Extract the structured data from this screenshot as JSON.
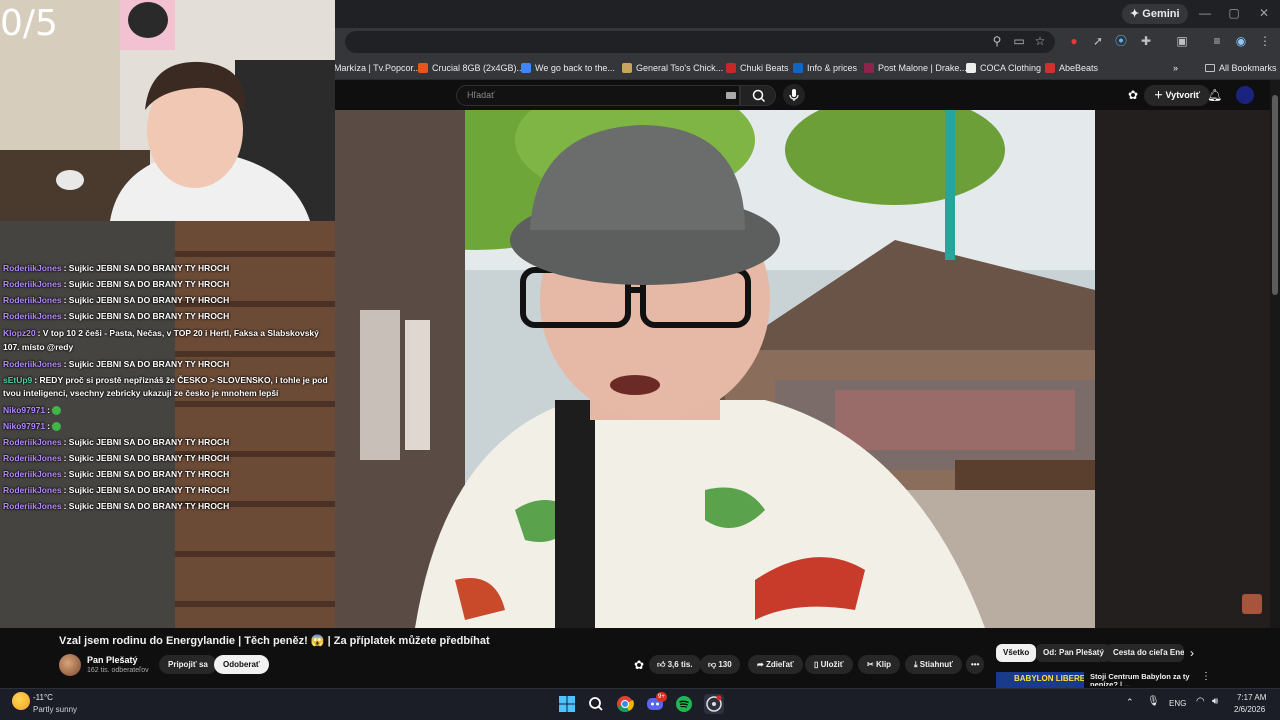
{
  "browser": {
    "gemini_label": "Gemini",
    "bookmarks": [
      {
        "label": "Markíza | Tv.Popcor...",
        "color": "#9aa0a6"
      },
      {
        "label": "Crucial 8GB (2x4GB)...",
        "color": "#e8561d"
      },
      {
        "label": "We go back to the...",
        "color": "#4285f4"
      },
      {
        "label": "General Tso's Chick...",
        "color": "#c9a45c"
      },
      {
        "label": "Chuki Beats",
        "color": "#c62828"
      },
      {
        "label": "Info & prices",
        "color": "#1565c0"
      },
      {
        "label": "Post Malone | Drake...",
        "color": "#8e244d"
      },
      {
        "label": "COCA Clothing",
        "color": "#eeeeee"
      },
      {
        "label": "AbeBeats",
        "color": "#d32f2f"
      }
    ],
    "all_bookmarks_label": "All Bookmarks"
  },
  "youtube": {
    "search_placeholder": "Hľadať",
    "create_label": "Vytvoriť",
    "video_title": "Vzal jsem rodinu do Energylandie | Těch peněz! 😱 | Za příplatek můžete předbíhat",
    "channel_name": "Pan Plešatý",
    "channel_subs": "162 tis. odberateľov",
    "join_label": "Pripojiť sa",
    "subscribe_label": "Odoberať",
    "likes": "3,6 tis.",
    "dislikes": "130",
    "share_label": "Zdieľať",
    "save_label": "Uložiť",
    "clip_label": "Klip",
    "download_label": "Stiahnuť",
    "more_label": "•••",
    "chips": [
      "Všetko",
      "Od: Pan Plešatý",
      "Cesta do cieľa Energ"
    ],
    "sidebar_video_title": "Stoji Centrum Babylon za ty peníze? | ...",
    "sidebar_video_thumb_text": "BABYLON LIBEREC"
  },
  "stream": {
    "counter": "0/5",
    "chat": [
      {
        "user": "RoderiikJones",
        "color": "#b388ff",
        "text": "Sujkic JEBNI SA DO BRANY TY HROCH"
      },
      {
        "user": "RoderiikJones",
        "color": "#b388ff",
        "text": "Sujkic JEBNI SA DO BRANY TY HROCH"
      },
      {
        "user": "RoderiikJones",
        "color": "#b388ff",
        "text": "Sujkic JEBNI SA DO BRANY TY HROCH"
      },
      {
        "user": "RoderiikJones",
        "color": "#b388ff",
        "text": "Sujkic JEBNI SA DO BRANY TY HROCH"
      },
      {
        "user": "Klopz20",
        "color": "#b388ff",
        "text": "V top 10 2 češi - Pasta, Nečas, v TOP 20 i Hertl, Faksa a Slabskovský 107. místo @redy"
      },
      {
        "user": "RoderiikJones",
        "color": "#b388ff",
        "text": "Sujkic JEBNI SA DO BRANY TY HROCH"
      },
      {
        "user": "sEtUp9",
        "color": "#4dd0a0",
        "text": "REDY proč si prostě nepřiznáš že ČESKO > SLOVENSKO, i tohle je pod tvou inteligenci, vsechny zebricky ukazuji ze česko je mnohem lepší"
      },
      {
        "user": "Niko97971",
        "color": "#b388ff",
        "text": "",
        "emote": true
      },
      {
        "user": "Niko97971",
        "color": "#b388ff",
        "text": "",
        "emote": true
      },
      {
        "user": "RoderiikJones",
        "color": "#b388ff",
        "text": "Sujkic JEBNI SA DO BRANY TY HROCH"
      },
      {
        "user": "RoderiikJones",
        "color": "#b388ff",
        "text": "Sujkic JEBNI SA DO BRANY TY HROCH"
      },
      {
        "user": "RoderiikJones",
        "color": "#b388ff",
        "text": "Sujkic JEBNI SA DO BRANY TY HROCH"
      },
      {
        "user": "RoderiikJones",
        "color": "#b388ff",
        "text": "Sujkic JEBNI SA DO BRANY TY HROCH"
      },
      {
        "user": "RoderiikJones",
        "color": "#b388ff",
        "text": "Sujkic JEBNI SA DO BRANY TY HROCH"
      }
    ]
  },
  "taskbar": {
    "weather_temp": "-11°C",
    "weather_desc": "Partly sunny",
    "discord_badge": "9+",
    "language": "ENG",
    "time": "7:17 AM",
    "date": "2/6/2026"
  }
}
